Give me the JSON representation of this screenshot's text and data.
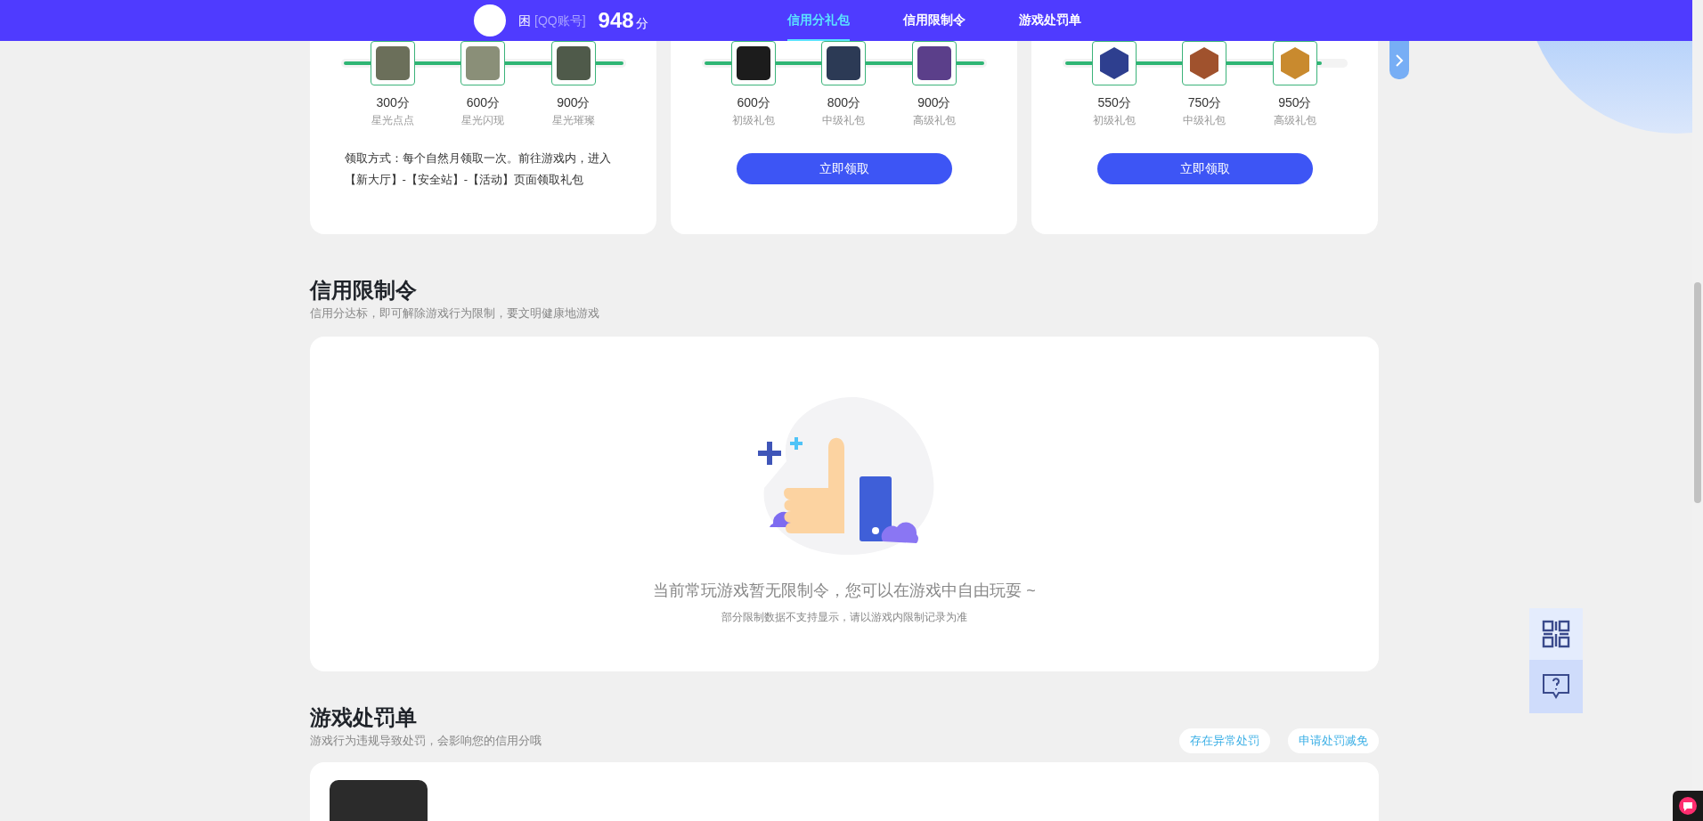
{
  "header": {
    "user": {
      "name": "困",
      "account_tag": "[QQ账号]",
      "score": "948",
      "score_unit": "分"
    },
    "tabs": [
      {
        "label": "信用分礼包",
        "selected": true
      },
      {
        "label": "信用限制令",
        "selected": false
      },
      {
        "label": "游戏处罚单",
        "selected": false
      }
    ]
  },
  "gift_cards": [
    {
      "kind": "note",
      "level": 1,
      "rewards": [
        {
          "score": "300分",
          "name": "星光点点"
        },
        {
          "score": "600分",
          "name": "星光闪现"
        },
        {
          "score": "900分",
          "name": "星光璀璨"
        }
      ],
      "note": "领取方式：每个自然月领取一次。前往游戏内，进入【新大厅】-【安全站】-【活动】页面领取礼包"
    },
    {
      "kind": "button",
      "level": 1,
      "rewards": [
        {
          "score": "600分",
          "name": "初级礼包"
        },
        {
          "score": "800分",
          "name": "中级礼包"
        },
        {
          "score": "900分",
          "name": "高级礼包"
        }
      ],
      "button": "立即领取"
    },
    {
      "kind": "button",
      "level": 0.92,
      "rewards": [
        {
          "score": "550分",
          "name": "初级礼包"
        },
        {
          "score": "750分",
          "name": "中级礼包"
        },
        {
          "score": "950分",
          "name": "高级礼包"
        }
      ],
      "button": "立即领取"
    }
  ],
  "restrictions": {
    "title": "信用限制令",
    "subtitle": "信用分达标，即可解除游戏行为限制，要文明健康地游戏",
    "empty_message": "当前常玩游戏暂无限制令，您可以在游戏中自由玩耍 ~",
    "empty_note": "部分限制数据不支持显示，请以游戏内限制记录为准"
  },
  "penalties": {
    "title": "游戏处罚单",
    "subtitle": "游戏行为违规导致处罚，会影响您的信用分哦",
    "actions": [
      "存在异常处罚",
      "申请处罚减免"
    ]
  }
}
